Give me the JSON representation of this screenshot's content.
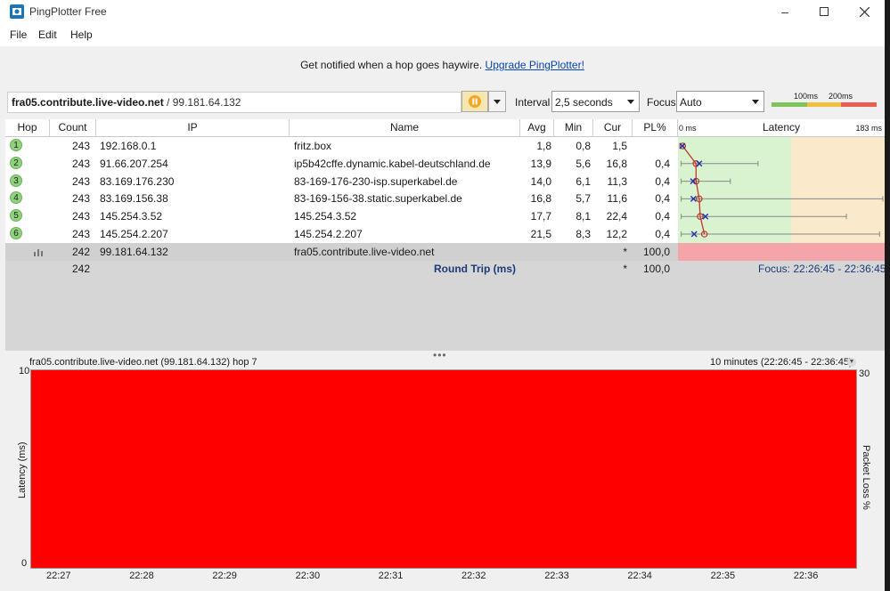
{
  "window": {
    "title": "PingPlotter Free"
  },
  "menu": [
    "File",
    "Edit",
    "Help"
  ],
  "notice": {
    "text": "Get notified when a hop goes haywire. ",
    "link": "Upgrade PingPlotter!"
  },
  "target": {
    "host": "fra05.contribute.live-video.net",
    "ip": " / 99.181.64.132"
  },
  "controls": {
    "interval_label": "Interval",
    "interval_value": "2,5 seconds",
    "focus_label": "Focus",
    "focus_value": "Auto"
  },
  "scale": {
    "label_100": "100ms",
    "label_200": "200ms",
    "colors": [
      "#7fc35a",
      "#f0c040",
      "#e86050"
    ]
  },
  "table": {
    "headers": [
      "Hop",
      "Count",
      "IP",
      "Name",
      "Avg",
      "Min",
      "Cur",
      "PL%",
      "Latency"
    ],
    "latency_min": "0 ms",
    "latency_max": "183 ms",
    "rows": [
      {
        "hop": "1",
        "count": "243",
        "ip": "192.168.0.1",
        "name": "fritz.box",
        "avg": "1,8",
        "min": "0,8",
        "cur": "1,5",
        "pl": "",
        "avg_ms": 1.8,
        "cur_ms": 1.5,
        "max_ms": 3
      },
      {
        "hop": "2",
        "count": "243",
        "ip": "91.66.207.254",
        "name": "ip5b42cffe.dynamic.kabel-deutschland.de",
        "avg": "13,9",
        "min": "5,6",
        "cur": "16,8",
        "pl": "0,4",
        "avg_ms": 13.9,
        "cur_ms": 16.8,
        "max_ms": 70
      },
      {
        "hop": "3",
        "count": "243",
        "ip": "83.169.176.230",
        "name": "83-169-176-230-isp.superkabel.de",
        "avg": "14,0",
        "min": "6,1",
        "cur": "11,3",
        "pl": "0,4",
        "avg_ms": 14.0,
        "cur_ms": 11.3,
        "max_ms": 45
      },
      {
        "hop": "4",
        "count": "243",
        "ip": "83.169.156.38",
        "name": "83-169-156-38.static.superkabel.de",
        "avg": "16,8",
        "min": "5,7",
        "cur": "11,6",
        "pl": "0,4",
        "avg_ms": 16.8,
        "cur_ms": 11.6,
        "max_ms": 183
      },
      {
        "hop": "5",
        "count": "243",
        "ip": "145.254.3.52",
        "name": "145.254.3.52",
        "avg": "17,7",
        "min": "8,1",
        "cur": "22,4",
        "pl": "0,4",
        "avg_ms": 17.7,
        "cur_ms": 22.4,
        "max_ms": 150
      },
      {
        "hop": "6",
        "count": "243",
        "ip": "145.254.2.207",
        "name": "145.254.2.207",
        "avg": "21,5",
        "min": "8,3",
        "cur": "12,2",
        "pl": "0,4",
        "avg_ms": 21.5,
        "cur_ms": 12.2,
        "max_ms": 180
      }
    ],
    "final": {
      "count": "242",
      "ip": "99.181.64.132",
      "name": "fra05.contribute.live-video.net",
      "cur": "*",
      "pl": "100,0"
    },
    "summary": {
      "count": "242",
      "label": "Round Trip (ms)",
      "cur": "*",
      "pl": "100,0",
      "focus": "Focus: 22:26:45 - 22:36:45"
    }
  },
  "graph": {
    "title": "fra05.contribute.live-video.net (99.181.64.132) hop 7",
    "range": "10 minutes (22:26:45 - 22:36:45)",
    "y_left_label": "Latency (ms)",
    "y_right_label": "Packet Loss %",
    "y_left_max": "10",
    "y_left_min": "0",
    "y_right_max": "30",
    "x_ticks": [
      "22:27",
      "22:28",
      "22:29",
      "22:30",
      "22:31",
      "22:32",
      "22:33",
      "22:34",
      "22:35",
      "22:36"
    ],
    "fill_color": "#ff0000"
  }
}
